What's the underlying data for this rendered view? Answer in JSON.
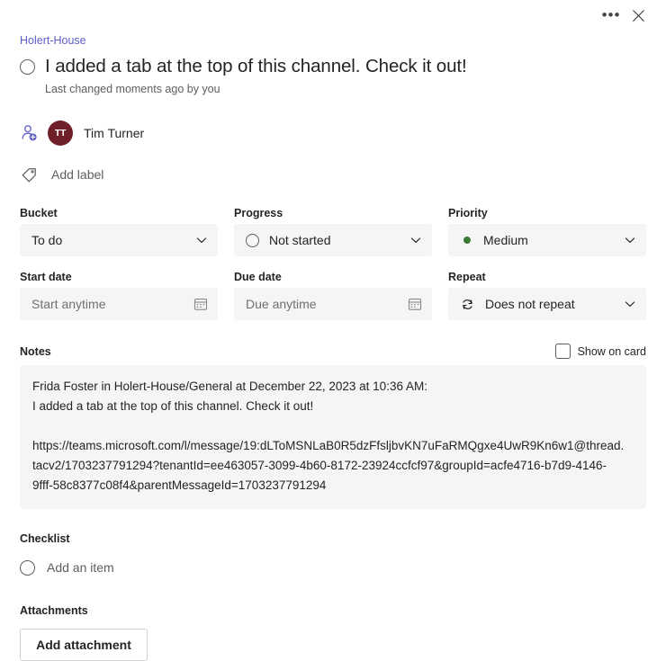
{
  "topbar": {
    "more_label": "•••",
    "close_label": "✕"
  },
  "header": {
    "breadcrumb": "Holert-House",
    "title": "I added a tab at the top of this channel. Check it out!",
    "subtitle": "Last changed moments ago by you"
  },
  "assignee": {
    "avatar_initials": "TT",
    "name": "Tim Turner",
    "avatar_color": "#6e1f28"
  },
  "label": {
    "add_label": "Add label"
  },
  "fields": {
    "bucket": {
      "label": "Bucket",
      "value": "To do"
    },
    "progress": {
      "label": "Progress",
      "value": "Not started"
    },
    "priority": {
      "label": "Priority",
      "value": "Medium",
      "dot_color": "#3d7a35"
    },
    "start_date": {
      "label": "Start date",
      "placeholder": "Start anytime"
    },
    "due_date": {
      "label": "Due date",
      "placeholder": "Due anytime"
    },
    "repeat": {
      "label": "Repeat",
      "value": "Does not repeat"
    }
  },
  "notes": {
    "title": "Notes",
    "show_on_card": "Show on card",
    "line1": "Frida Foster in Holert-House/General at December 22, 2023 at 10:36 AM:",
    "line2": "I added a tab at the top of this channel. Check it out!",
    "url_line1": "https://teams.microsoft.com/l/message/19:dLToMSNLaB0R5dzFfsljbvKN7uFaRMQgxe4UwR9Kn6w1@thread.",
    "url_line2": "tacv2/1703237791294?tenantId=ee463057-3099-4b60-8172-23924ccfcf97&groupId=acfe4716-b7d9-4146-",
    "url_line3": "9fff-58c8377c08f4&parentMessageId=1703237791294"
  },
  "checklist": {
    "title": "Checklist",
    "add_item": "Add an item"
  },
  "attachments": {
    "title": "Attachments",
    "add_button": "Add attachment"
  }
}
